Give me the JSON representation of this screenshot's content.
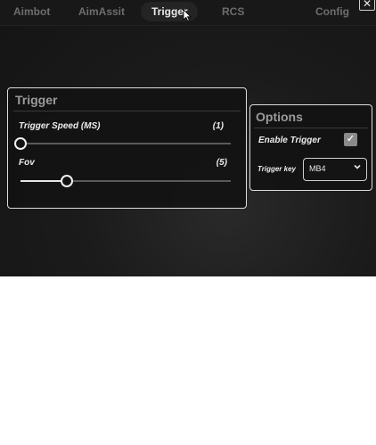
{
  "nav": {
    "tabs": [
      {
        "label": "Aimbot"
      },
      {
        "label": "AimAssit"
      },
      {
        "label": "Trigger"
      },
      {
        "label": "RCS"
      },
      {
        "label": "Config"
      }
    ],
    "active_tab": "Trigger",
    "close_label": "✕"
  },
  "trigger_panel": {
    "title": "Trigger",
    "trigger_speed": {
      "label": "Trigger Speed (MS)",
      "value_text": "(1)",
      "fraction": 0.0
    },
    "fov": {
      "label": "Fov",
      "value_text": "(5)",
      "fraction": 0.22
    }
  },
  "options_panel": {
    "title": "Options",
    "enable_trigger": {
      "label": "Enable Trigger",
      "checked": true,
      "check_glyph": "✓"
    },
    "trigger_key": {
      "label": "Trigger key",
      "value": "MB4",
      "chevron": "⌄"
    }
  },
  "colors": {
    "background": "#1b1b1b",
    "accent": "#e6e6e6",
    "muted_tab": "#6d6d6d",
    "panel_border": "#dcdcdc"
  }
}
